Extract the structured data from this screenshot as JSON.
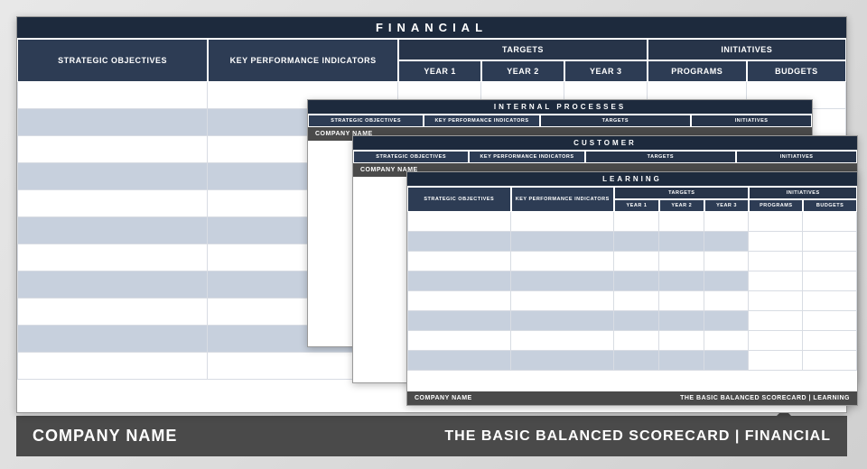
{
  "colors": {
    "darkHeader": "#1d2a3d",
    "colHeader": "#2d3c54",
    "altRow": "#c7d0dd",
    "footer": "#4a4a4a"
  },
  "page_footer": {
    "company": "COMPANY NAME",
    "title": "THE BASIC BALANCED SCORECARD | FINANCIAL"
  },
  "panels": {
    "main": {
      "title": "FINANCIAL",
      "headers": {
        "strategic": "STRATEGIC OBJECTIVES",
        "kpi": "KEY PERFORMANCE INDICATORS",
        "targets_group": "TARGETS",
        "initiatives_group": "INITIATIVES",
        "year1": "YEAR 1",
        "year2": "YEAR 2",
        "year3": "YEAR 3",
        "programs": "PROGRAMS",
        "budgets": "BUDGETS"
      },
      "footer_left": "COMPANY NAME",
      "footer_right": "THE BASIC BALANCED SCORECARD | FINANCIAL"
    },
    "stack1": {
      "title": "INTERNAL  PROCESSES",
      "headers": {
        "strategic": "STRATEGIC OBJECTIVES",
        "kpi": "KEY PERFORMANCE INDICATORS",
        "targets_group": "TARGETS",
        "initiatives_group": "INITIATIVES"
      },
      "footer_left": "COMPANY NAME",
      "footer_right": ""
    },
    "stack2": {
      "title": "CUSTOMER",
      "headers": {
        "strategic": "STRATEGIC OBJECTIVES",
        "kpi": "KEY PERFORMANCE INDICATORS",
        "targets_group": "TARGETS",
        "initiatives_group": "INITIATIVES"
      },
      "footer_left": "COMPANY NAME",
      "footer_right": ""
    },
    "stack3": {
      "title": "LEARNING",
      "headers": {
        "strategic": "STRATEGIC OBJECTIVES",
        "kpi": "KEY PERFORMANCE INDICATORS",
        "targets_group": "TARGETS",
        "initiatives_group": "INITIATIVES",
        "year1": "YEAR 1",
        "year2": "YEAR 2",
        "year3": "YEAR 3",
        "programs": "PROGRAMS",
        "budgets": "BUDGETS"
      },
      "footer_left": "COMPANY NAME",
      "footer_right": "THE BASIC BALANCED SCORECARD | LEARNING"
    }
  }
}
